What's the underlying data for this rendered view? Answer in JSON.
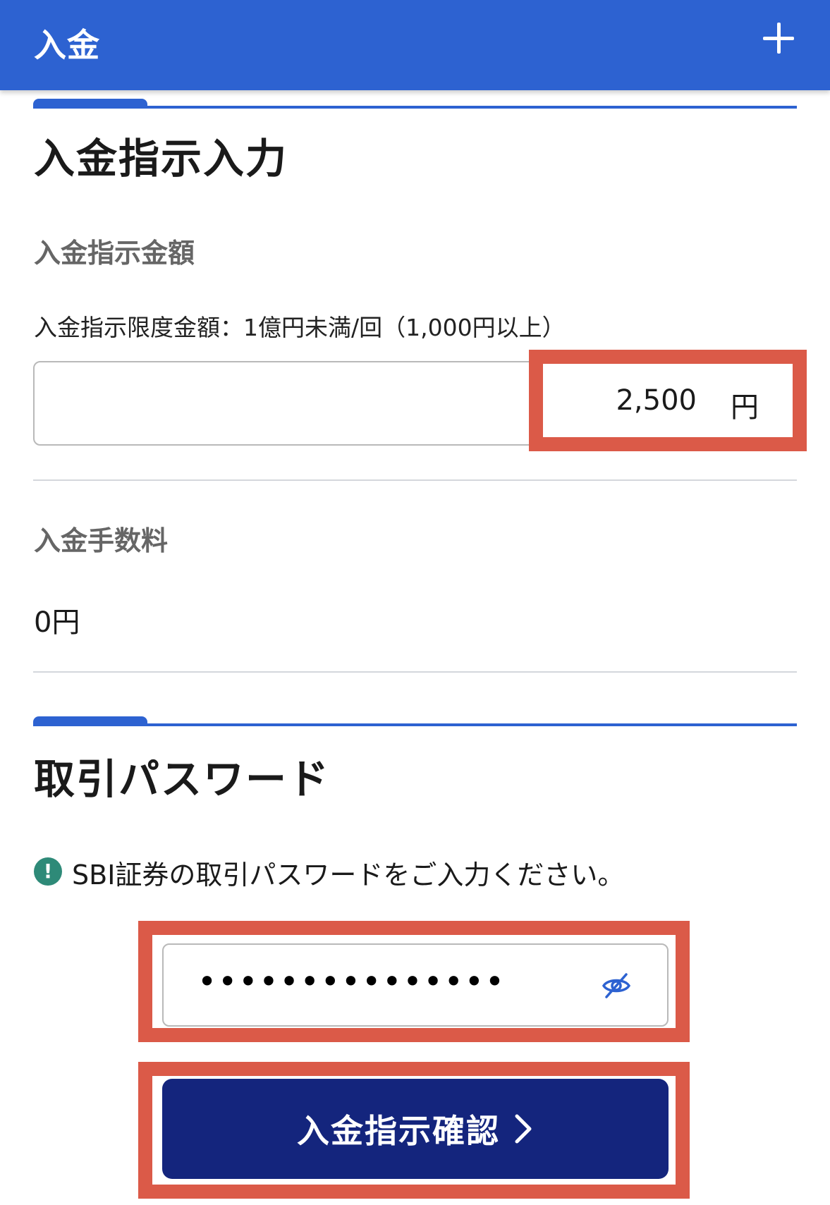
{
  "header": {
    "title": "入金",
    "add_icon": "plus-icon"
  },
  "deposit_section": {
    "title": "入金指示入力",
    "amount_label": "入金指示金額",
    "limit_note": "入金指示限度金額：1億円未満/回（1,000円以上）",
    "amount_value": "2,500",
    "amount_unit": "円",
    "fee_label": "入金手数料",
    "fee_value": "0円"
  },
  "password_section": {
    "title": "取引パスワード",
    "notice_icon": "exclamation-icon",
    "notice": "SBI証券の取引パスワードをご入力ください。",
    "masked_value": "•••••••••••••••",
    "visibility_icon": "eye-off-icon"
  },
  "confirm_button": {
    "label": "入金指示確認",
    "icon": "chevron-right-icon"
  },
  "colors": {
    "header": "#2d62d1",
    "section_accent": "#2d62d1",
    "button": "#14257d",
    "highlight": "#db5a48",
    "notice_icon": "#2e8a78"
  }
}
